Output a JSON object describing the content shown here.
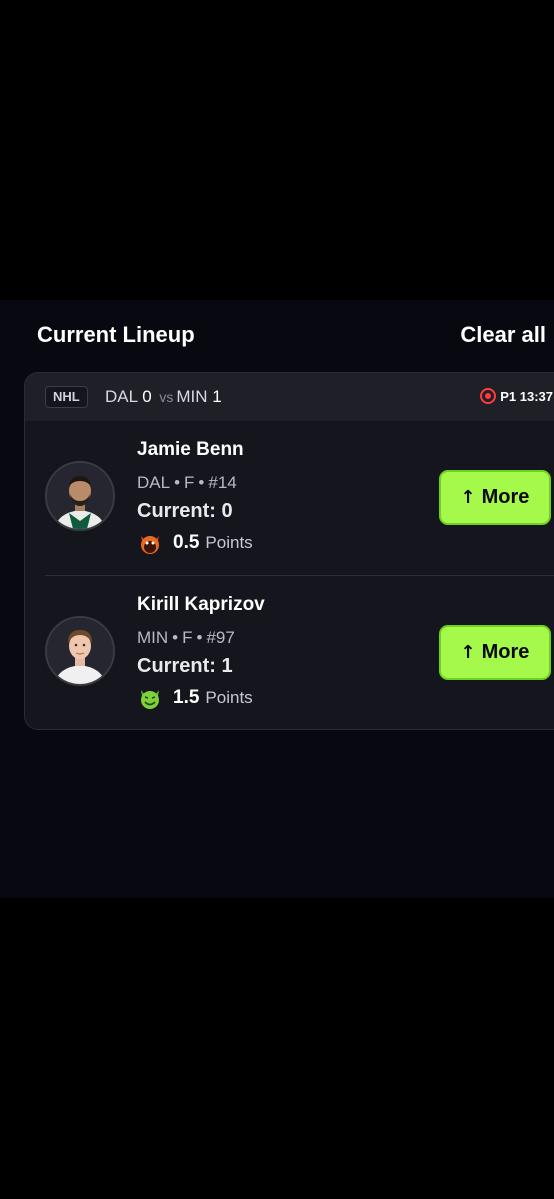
{
  "header": {
    "title": "Current Lineup",
    "clear_label": "Clear all"
  },
  "match": {
    "league": "NHL",
    "home_team": "DAL",
    "home_score": "0",
    "vs": "vs",
    "away_team": "MIN",
    "away_score": "1",
    "live_status": "P1 13:37",
    "live_color": "#ff3b3b"
  },
  "players": [
    {
      "name": "Jamie Benn",
      "team": "DAL",
      "position": "F",
      "number": "#14",
      "current_label": "Current:",
      "current_value": "0",
      "points_value": "0.5",
      "points_label": "Points",
      "icon": "red-devil-emoji-icon",
      "more_label": "More"
    },
    {
      "name": "Kirill Kaprizov",
      "team": "MIN",
      "position": "F",
      "number": "#97",
      "current_label": "Current:",
      "current_value": "1",
      "points_value": "1.5",
      "points_label": "Points",
      "icon": "green-devil-emoji-icon",
      "more_label": "More"
    }
  ],
  "colors": {
    "accent": "#a4f94a",
    "background": "#080811",
    "card": "#15151d"
  }
}
